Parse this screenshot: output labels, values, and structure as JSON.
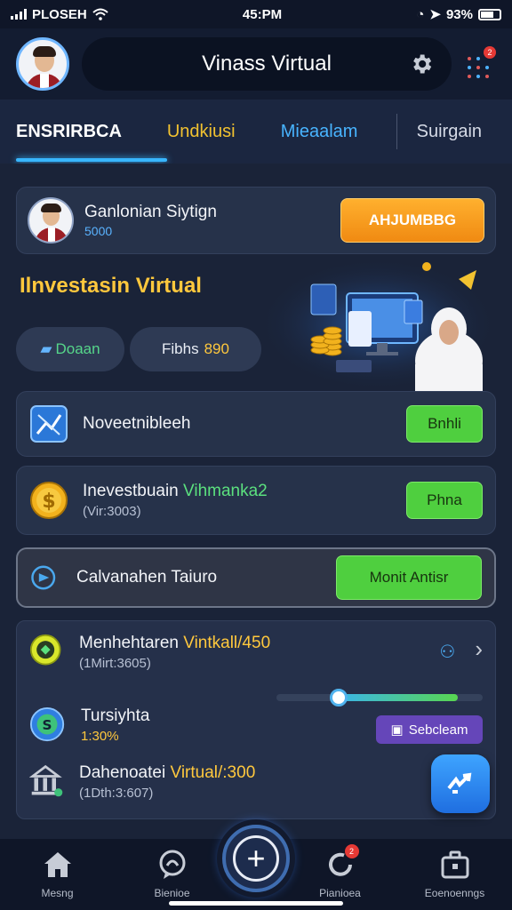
{
  "status_bar": {
    "carrier": "PLOSEH",
    "time": "45:PM",
    "battery": "93%"
  },
  "header": {
    "title": "Vinass Virtual",
    "icons": [
      "avatar",
      "gear-icon",
      "apps-grid-icon"
    ],
    "notification_count": "2"
  },
  "tabs": [
    {
      "label": "ENSRIRBCA"
    },
    {
      "label": "Undkiusi"
    },
    {
      "label": "Mieaalam"
    },
    {
      "label": "Suirgain"
    }
  ],
  "profile": {
    "name": "Ganlonian Siytign",
    "sub": "5000",
    "action": "AHJUMBBG"
  },
  "hero": {
    "title": "Ilnvestasin Virtual",
    "chip1": "Doaan",
    "chip2_label": "Fibhs",
    "chip2_value": "890"
  },
  "cards": [
    {
      "title": "Noveetnibleeh",
      "button": "Bnhli",
      "icon": "chart-icon"
    },
    {
      "title": "Inevestbuain",
      "title_highlight": "Vihmanka2",
      "sub": "(Vir:3003)",
      "button": "Phna",
      "icon": "dollar-coin-icon"
    },
    {
      "title": "Calvanahen  Taiuro",
      "button": "Monit Antisr",
      "icon": "play-circle-icon"
    }
  ],
  "list": [
    {
      "title": "Menhehtaren",
      "title_highlight": "Vintkall/450",
      "sub": "(1Mirt:3605)",
      "progress": 0.3
    },
    {
      "title": "Tursiyhta",
      "sub": "1:30%",
      "button": "Sebcleam"
    },
    {
      "title": "Dahenoatei",
      "title_highlight": "Virtual/:300",
      "sub": "(1Dth:3:607)"
    }
  ],
  "bottom_nav": [
    {
      "label": "Mesng",
      "icon": "home-icon"
    },
    {
      "label": "Bienioe",
      "icon": "chat-icon"
    },
    {
      "label": "Pianioea",
      "icon": "refresh-icon",
      "badge": "2"
    },
    {
      "label": "Eoenoenngs",
      "icon": "briefcase-icon"
    }
  ],
  "colors": {
    "accent": "#38b6ff",
    "yellow": "#ffc83d",
    "green": "#4fcf3f",
    "orange": "#f08a12"
  }
}
